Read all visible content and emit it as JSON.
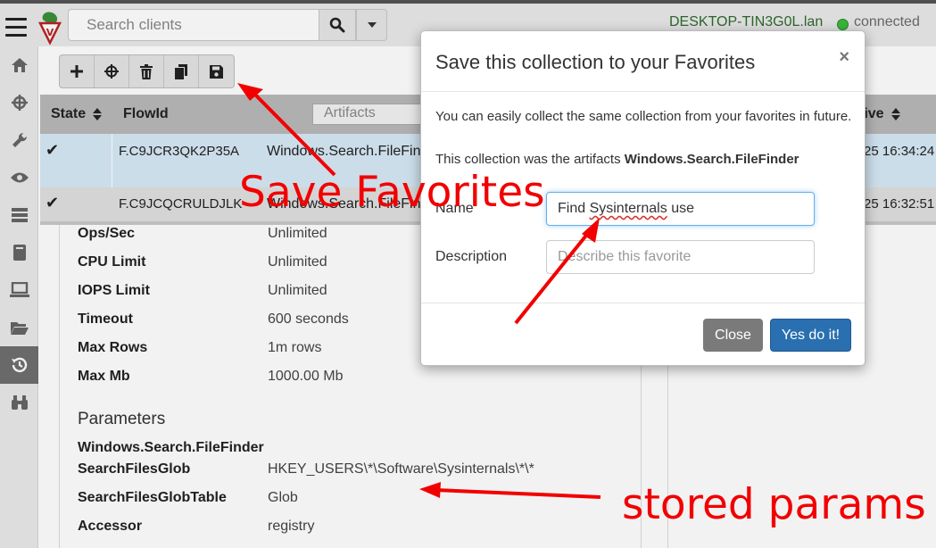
{
  "navbar": {
    "search_placeholder": "Search clients",
    "hostname": "DESKTOP-TIN3G0L.lan",
    "connection_status": "connected"
  },
  "sidebar": {
    "items": [
      "home-icon",
      "crosshairs-icon",
      "wrench-icon",
      "eye-icon",
      "server-icon",
      "book-icon",
      "laptop-icon",
      "folder-open-icon",
      "history-icon",
      "binoculars-icon"
    ],
    "active_item": "history-icon"
  },
  "toolbar": {
    "buttons": [
      "plus-icon",
      "crosshairs-icon",
      "trash-icon",
      "copy-icon",
      "save-icon"
    ]
  },
  "table": {
    "columns": {
      "state": "State",
      "flow_id": "FlowId",
      "artifacts_filter": "Artifacts",
      "last_active": "tive"
    },
    "rows": [
      {
        "state_icon": "✔",
        "flow_id": "F.C9JCR3QK2P35A",
        "artifact": "Windows.Search.FileFinder",
        "last_active": "25 16:34:24"
      },
      {
        "state_icon": "✔",
        "flow_id": "F.C9JCQCRULDJLK",
        "artifact": "Windows.Search.FileFinder",
        "last_active": "25 16:32:51"
      }
    ]
  },
  "details": {
    "limits": [
      {
        "label": "Ops/Sec",
        "value": "Unlimited"
      },
      {
        "label": "CPU Limit",
        "value": "Unlimited"
      },
      {
        "label": "IOPS Limit",
        "value": "Unlimited"
      },
      {
        "label": "Timeout",
        "value": "600 seconds"
      },
      {
        "label": "Max Rows",
        "value": "1m rows"
      },
      {
        "label": "Max Mb",
        "value": "1000.00 Mb"
      }
    ],
    "parameters_heading": "Parameters",
    "artifact_name": "Windows.Search.FileFinder",
    "params": [
      {
        "label": "SearchFilesGlob",
        "value": "HKEY_USERS\\*\\Software\\Sysinternals\\*\\*"
      },
      {
        "label": "SearchFilesGlobTable",
        "value": "Glob"
      },
      {
        "label": "Accessor",
        "value": "registry"
      }
    ]
  },
  "modal": {
    "title": "Save this collection to your Favorites",
    "close_symbol": "×",
    "intro_line1": "You can easily collect the same collection from your favorites in future.",
    "intro_line2_prefix": "This collection was the artifacts",
    "intro_line2_artifact": "Windows.Search.FileFinder",
    "name_label": "Name",
    "name_value_prefix": "Find",
    "name_value_misspelled": "Sysinternals",
    "name_value_suffix": "use",
    "description_label": "Description",
    "description_placeholder": "Describe this favorite",
    "close_button": "Close",
    "confirm_button": "Yes do it!"
  },
  "annotations": {
    "save_favorites": "Save Favorites",
    "stored_params": "stored params",
    "color": "#f20000"
  }
}
